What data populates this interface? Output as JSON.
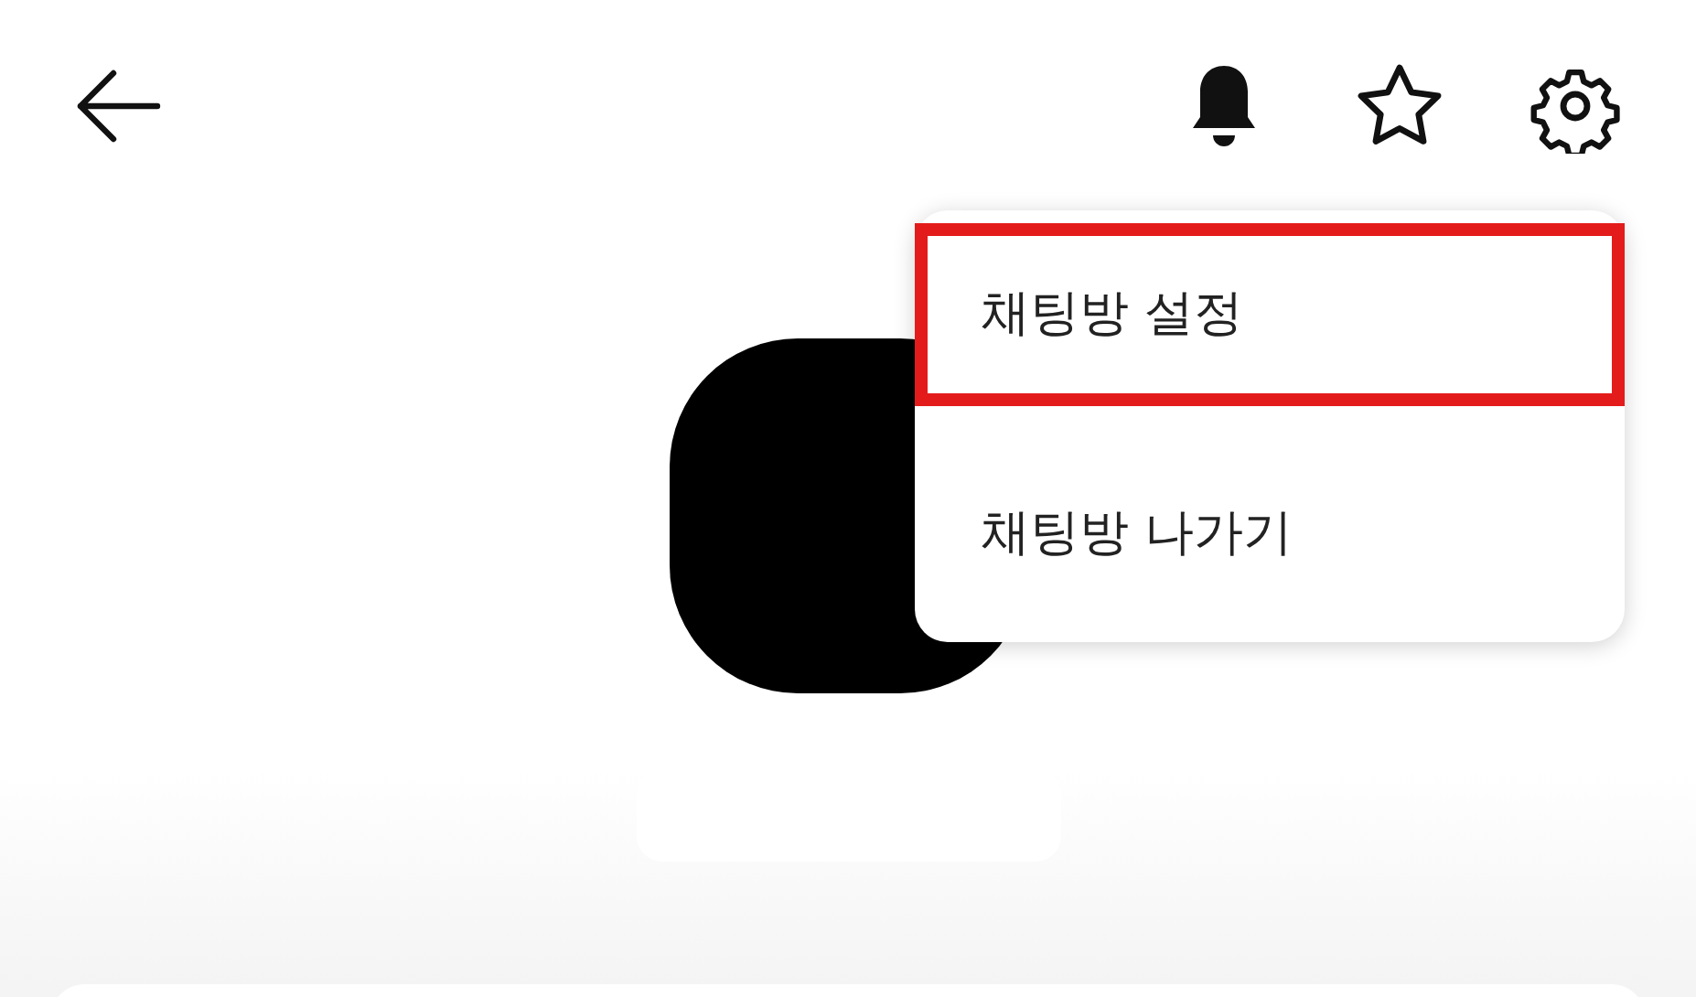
{
  "menu": {
    "items": [
      {
        "label": "채팅방 설정",
        "highlighted": true
      },
      {
        "label": "채팅방 나가기",
        "highlighted": false
      }
    ]
  }
}
